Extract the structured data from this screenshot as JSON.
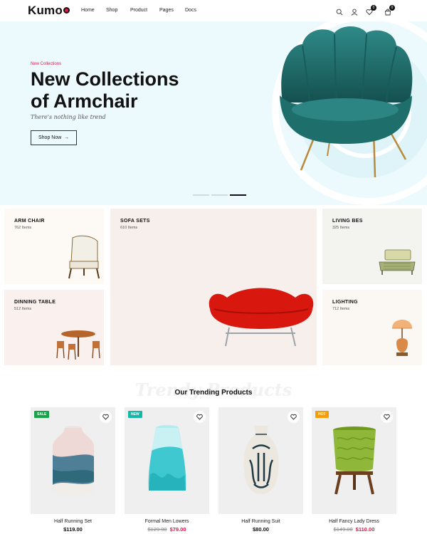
{
  "brand": {
    "name": "Kumo",
    "accent": "#e4154b"
  },
  "nav": {
    "items": [
      "Home",
      "Shop",
      "Product",
      "Pages",
      "Docs"
    ]
  },
  "header_icons": [
    {
      "name": "search-icon"
    },
    {
      "name": "user-icon"
    },
    {
      "name": "wishlist-icon",
      "badge": "0"
    },
    {
      "name": "cart-icon",
      "badge": "0"
    }
  ],
  "hero": {
    "kicker": "New Collections",
    "title_line1": "New Collections",
    "title_line2": "of Armchair",
    "subtitle": "There's nothing like trend",
    "button_label": "Shop Now",
    "button_arrow": "→",
    "slides_active_index": 2,
    "slides_total": 3
  },
  "categories": [
    {
      "title": "ARM CHAIR",
      "count": "762 Items"
    },
    {
      "title": "SOFA SETS",
      "count": "610 Items"
    },
    {
      "title": "LIVING BES",
      "count": "325 Items"
    },
    {
      "title": "DINNING TABLE",
      "count": "512 Items"
    },
    {
      "title": "LIGHTING",
      "count": "712 Items"
    }
  ],
  "trending": {
    "watermark": "Trendy Products",
    "title": "Our Trending Products",
    "products": [
      {
        "name": "Half Running Set",
        "old_price": "",
        "price": "$119.00",
        "tag": "SALE",
        "tag_color": "#16a34a"
      },
      {
        "name": "Formal Men Lowers",
        "old_price": "$129.00",
        "price": "$79.00",
        "tag": "NEW",
        "tag_color": "#14b8a6"
      },
      {
        "name": "Half Running Suit",
        "old_price": "",
        "price": "$80.00",
        "tag": "",
        "tag_color": ""
      },
      {
        "name": "Half Fancy Lady Dress",
        "old_price": "$149.00",
        "price": "$110.00",
        "tag": "HOT",
        "tag_color": "#f59e0b"
      }
    ]
  }
}
